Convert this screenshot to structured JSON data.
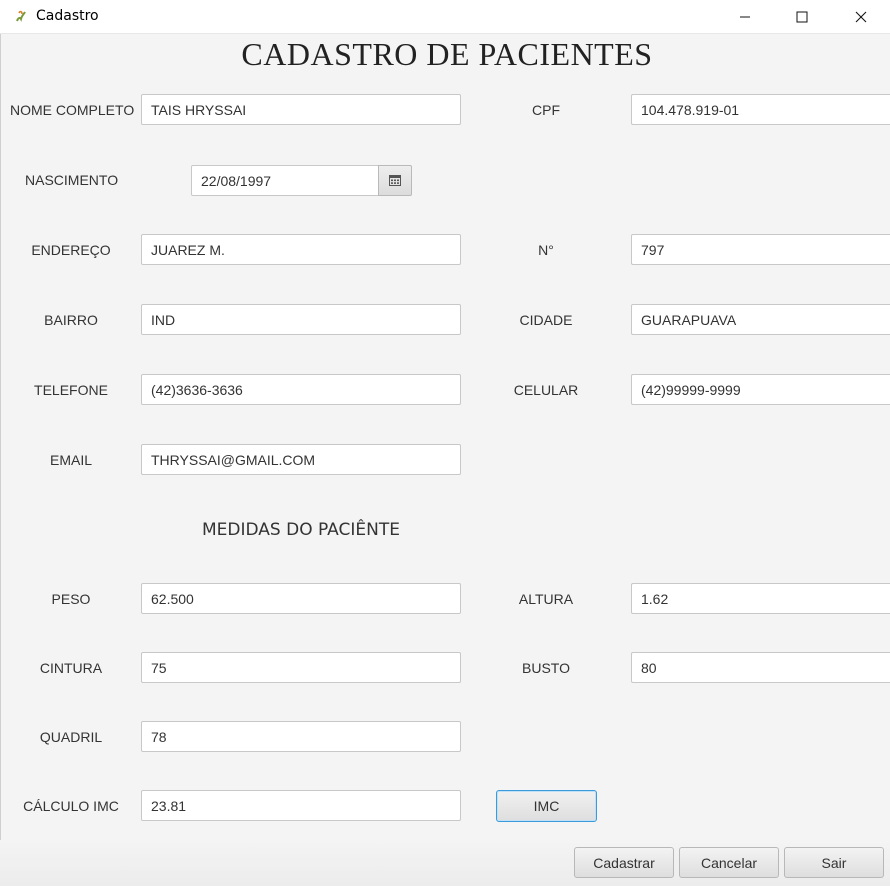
{
  "window": {
    "title": "Cadastro",
    "icon": "java-cup-icon"
  },
  "heading": "CADASTRO DE PACIENTES",
  "labels": {
    "nome": "NOME COMPLETO",
    "cpf": "CPF",
    "nascimento": "NASCIMENTO",
    "endereco": "ENDEREÇO",
    "numero": "N°",
    "bairro": "BAIRRO",
    "cidade": "CIDADE",
    "telefone": "TELEFONE",
    "celular": "CELULAR",
    "email": "EMAIL",
    "peso": "PESO",
    "altura": "ALTURA",
    "cintura": "CINTURA",
    "busto": "BUSTO",
    "quadril": "QUADRIL",
    "imc": "CÁLCULO IMC"
  },
  "values": {
    "nome": "TAIS HRYSSAI",
    "cpf": "104.478.919-01",
    "nascimento": "22/08/1997",
    "endereco": "JUAREZ M.",
    "numero": "797",
    "bairro": "IND",
    "cidade": "GUARAPUAVA",
    "telefone": "(42)3636-3636",
    "celular": "(42)99999-9999",
    "email": "THRYSSAI@GMAIL.COM",
    "peso": "62.500",
    "altura": "1.62",
    "cintura": "75",
    "busto": "80",
    "quadril": "78",
    "imc": "23.81"
  },
  "section_title": "MEDIDAS DO PACIÊNTE",
  "buttons": {
    "imc": "IMC",
    "cadastrar": "Cadastrar",
    "cancelar": "Cancelar",
    "sair": "Sair"
  },
  "colors": {
    "focus_border": "#3b9ad9",
    "background": "#f4f4f4"
  }
}
